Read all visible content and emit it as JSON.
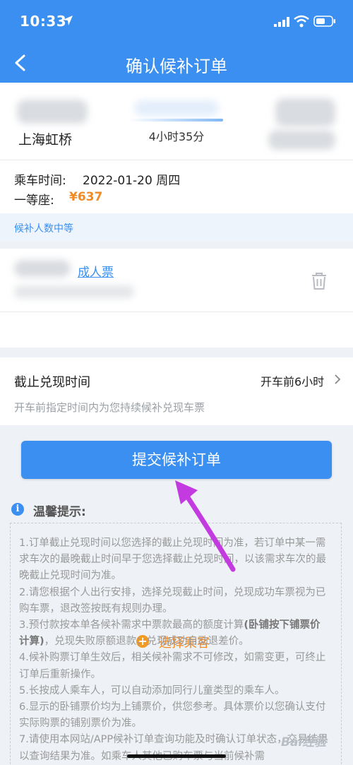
{
  "status_bar": {
    "time": "10:33"
  },
  "nav": {
    "title": "确认候补订单"
  },
  "train": {
    "departure_station": "上海虹桥",
    "duration": "4小时35分"
  },
  "ride": {
    "time_label": "乘车时间:",
    "date": "2022-01-20 周四",
    "seat_label": "一等座:",
    "price": "¥637",
    "queue_status": "候补人数中等"
  },
  "passenger": {
    "ticket_type": "成人票",
    "add_label": "选择乘客"
  },
  "deadline": {
    "title": "截止兑现时间",
    "value": "开车前6小时",
    "description": "开车前指定时间内为您持续候补兑现车票"
  },
  "submit": {
    "label": "提交候补订单"
  },
  "tips": {
    "title": "温馨提示:",
    "items": [
      "1.订单截止兑现时间以您选择的截止兑现时间为准，若订单中某一需求车次的最晚截止时间早于您选择截止兑现时间，以该需求车次的最晚截止兑现时间为准。",
      "2.请您根据个人出行安排，选择兑现截止时间，兑现成功车票视为已购车票，退改签按既有规则办理。",
      "3.预付款按本单各候补需求中票款最高的额度计算",
      "(卧铺按下铺票价计算)",
      "，兑现失败原额退款；兑现成功自动退差价。",
      "4.候补购票订单生效后，相关候补需求不可修改，如需变更，可终止订单后重新操作。",
      "5.长按成人乘车人，可以自动添加同行儿童类型的乘车人。",
      "6.显示的卧铺票价均为上铺票价，供您参考。具体票价以您确认支付实际购票的铺别票价为准。",
      "7.请使用本网站/APP候补订单查询功能及时确认订单状态，交易结果以查询结果为准。如乘车人其他已购车票与当前候补需"
    ]
  },
  "watermark": "Bai经验"
}
